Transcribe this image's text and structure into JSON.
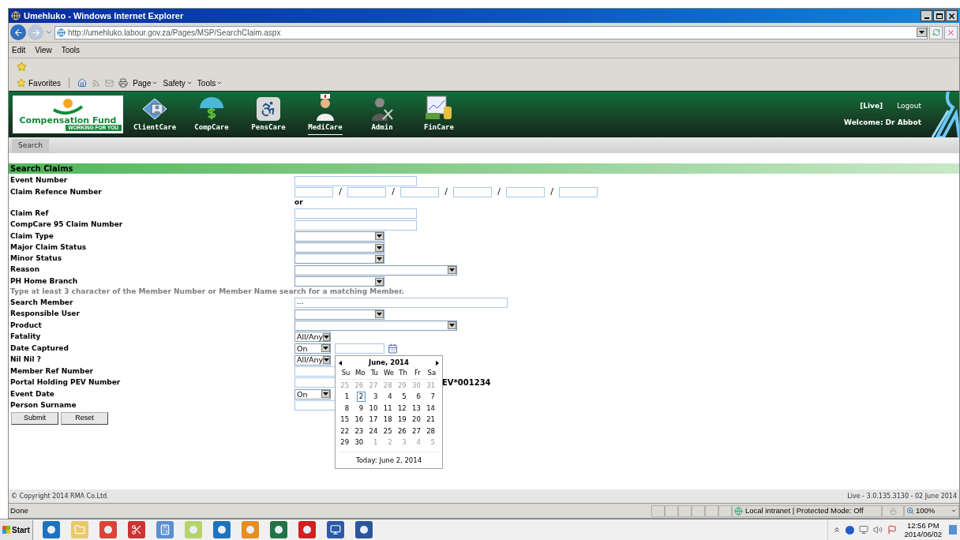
{
  "window": {
    "title": "Umehluko - Windows Internet Explorer"
  },
  "address_bar": {
    "url": "http://umehluko.labour.gov.za/Pages/MSP/SearchClaim.aspx"
  },
  "menu_bar": [
    "Edit",
    "View",
    "Tools"
  ],
  "command_bar": {
    "favorites": "Favorites",
    "menus": [
      "Page",
      "Safety",
      "Tools"
    ]
  },
  "app_header": {
    "logo_title": "Compensation Fund",
    "logo_tagline": "WORKING FOR YOU",
    "modules": [
      {
        "label": "ClientCare",
        "selected": false
      },
      {
        "label": "CompCare",
        "selected": false
      },
      {
        "label": "PensCare",
        "selected": false
      },
      {
        "label": "MediCare",
        "selected": true
      },
      {
        "label": "Admin",
        "selected": false
      },
      {
        "label": "FinCare",
        "selected": false
      }
    ],
    "environment": "[Live]",
    "logout": "Logout",
    "welcome": "Welcome: Dr Abbot"
  },
  "sub_tabs": [
    {
      "label": "Search",
      "selected": true
    }
  ],
  "form": {
    "title": "Search Claims",
    "rows": [
      {
        "kind": "text",
        "label": "Event Number"
      },
      {
        "kind": "ref",
        "label": "Claim Refence Number",
        "separators": [
          "/",
          "/",
          "/",
          "/",
          "/"
        ]
      },
      {
        "kind": "note",
        "text": "or"
      },
      {
        "kind": "text",
        "label": "Claim Ref"
      },
      {
        "kind": "text",
        "label": "CompCare 95 Claim Number"
      },
      {
        "kind": "select",
        "label": "Claim Type"
      },
      {
        "kind": "select",
        "label": "Major Claim Status"
      },
      {
        "kind": "select",
        "label": "Minor Status"
      },
      {
        "kind": "wide_select",
        "label": "Reason"
      },
      {
        "kind": "select",
        "label": "PH Home Branch"
      },
      {
        "kind": "hint",
        "text": "Type at least 3 character of the Member Number or Member Name search for a matching Member."
      },
      {
        "kind": "search",
        "label": "Search Member",
        "value": "..."
      },
      {
        "kind": "select",
        "label": "Responsible User"
      },
      {
        "kind": "wide_select",
        "label": "Product"
      },
      {
        "kind": "small_select",
        "label": "Fatality",
        "value": "All/Any"
      },
      {
        "kind": "date",
        "label": "Date Captured",
        "value": "On",
        "picker_open": true
      },
      {
        "kind": "small_select",
        "label": "Nil Nil ?",
        "value": "All/Any"
      },
      {
        "kind": "text",
        "label": "Member Ref Number"
      },
      {
        "kind": "text",
        "label": "Portal Holding PEV Number",
        "suffix": "EV*001234"
      },
      {
        "kind": "date",
        "label": "Event Date",
        "value": "On",
        "picker_open": false
      },
      {
        "kind": "text",
        "label": "Person Surname"
      }
    ],
    "buttons": [
      "Submit",
      "Reset"
    ]
  },
  "calendar": {
    "month": "June, 2014",
    "weekdays": [
      "Su",
      "Mo",
      "Tu",
      "We",
      "Th",
      "Fr",
      "Sa"
    ],
    "weeks": [
      [
        {
          "day": "25",
          "other_month": true,
          "selected": false
        },
        {
          "day": "26",
          "other_month": true,
          "selected": false
        },
        {
          "day": "27",
          "other_month": true,
          "selected": false
        },
        {
          "day": "28",
          "other_month": true,
          "selected": false
        },
        {
          "day": "29",
          "other_month": true,
          "selected": false
        },
        {
          "day": "30",
          "other_month": true,
          "selected": false
        },
        {
          "day": "31",
          "other_month": true,
          "selected": false
        }
      ],
      [
        {
          "day": "1",
          "other_month": false,
          "selected": false
        },
        {
          "day": "2",
          "other_month": false,
          "selected": true
        },
        {
          "day": "3",
          "other_month": false,
          "selected": false
        },
        {
          "day": "4",
          "other_month": false,
          "selected": false
        },
        {
          "day": "5",
          "other_month": false,
          "selected": false
        },
        {
          "day": "6",
          "other_month": false,
          "selected": false
        },
        {
          "day": "7",
          "other_month": false,
          "selected": false
        }
      ],
      [
        {
          "day": "8",
          "other_month": false,
          "selected": false
        },
        {
          "day": "9",
          "other_month": false,
          "selected": false
        },
        {
          "day": "10",
          "other_month": false,
          "selected": false
        },
        {
          "day": "11",
          "other_month": false,
          "selected": false
        },
        {
          "day": "12",
          "other_month": false,
          "selected": false
        },
        {
          "day": "13",
          "other_month": false,
          "selected": false
        },
        {
          "day": "14",
          "other_month": false,
          "selected": false
        }
      ],
      [
        {
          "day": "15",
          "other_month": false,
          "selected": false
        },
        {
          "day": "16",
          "other_month": false,
          "selected": false
        },
        {
          "day": "17",
          "other_month": false,
          "selected": false
        },
        {
          "day": "18",
          "other_month": false,
          "selected": false
        },
        {
          "day": "19",
          "other_month": false,
          "selected": false
        },
        {
          "day": "20",
          "other_month": false,
          "selected": false
        },
        {
          "day": "21",
          "other_month": false,
          "selected": false
        }
      ],
      [
        {
          "day": "22",
          "other_month": false,
          "selected": false
        },
        {
          "day": "23",
          "other_month": false,
          "selected": false
        },
        {
          "day": "24",
          "other_month": false,
          "selected": false
        },
        {
          "day": "25",
          "other_month": false,
          "selected": false
        },
        {
          "day": "26",
          "other_month": false,
          "selected": false
        },
        {
          "day": "27",
          "other_month": false,
          "selected": false
        },
        {
          "day": "28",
          "other_month": false,
          "selected": false
        }
      ],
      [
        {
          "day": "29",
          "other_month": false,
          "selected": false
        },
        {
          "day": "30",
          "other_month": false,
          "selected": false
        },
        {
          "day": "1",
          "other_month": true,
          "selected": false
        },
        {
          "day": "2",
          "other_month": true,
          "selected": false
        },
        {
          "day": "3",
          "other_month": true,
          "selected": false
        },
        {
          "day": "4",
          "other_month": true,
          "selected": false
        },
        {
          "day": "5",
          "other_month": true,
          "selected": false
        }
      ]
    ],
    "today": "Today: June 2, 2014"
  },
  "footer": {
    "copyright": "© Copyright 2014 RMA Co.Ltd.",
    "version": "Live - 3.0.135.3130 - 02 June 2014"
  },
  "status_bar": {
    "status": "Done",
    "zone": "Local intranet | Protected Mode: Off",
    "zoom": "100%"
  },
  "taskbar": {
    "start": "Start",
    "time": "12:56 PM",
    "date": "2014/06/02"
  }
}
